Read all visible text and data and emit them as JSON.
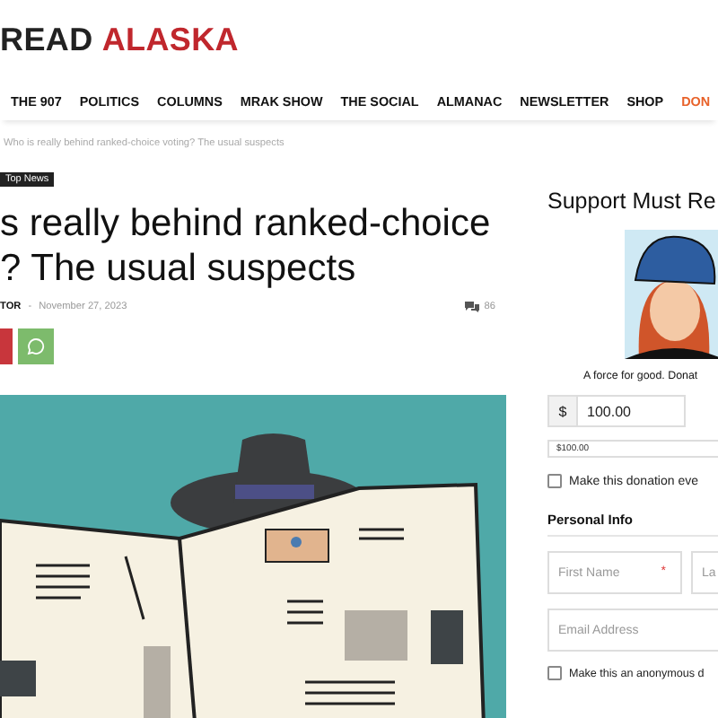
{
  "logo": {
    "dark": "READ",
    "accent": "ALASKA"
  },
  "nav": [
    {
      "label": "THE 907",
      "accent": false
    },
    {
      "label": "POLITICS",
      "accent": false
    },
    {
      "label": "COLUMNS",
      "accent": false
    },
    {
      "label": "MRAK SHOW",
      "accent": false
    },
    {
      "label": "THE SOCIAL",
      "accent": false
    },
    {
      "label": "ALMANAC",
      "accent": false
    },
    {
      "label": "NEWSLETTER",
      "accent": false
    },
    {
      "label": "SHOP",
      "accent": false
    },
    {
      "label": "DON",
      "accent": true
    }
  ],
  "breadcrumb": "Who is really behind ranked-choice voting? The usual suspects",
  "category": "Top News",
  "headline": [
    "s really behind ranked-choice",
    "? The usual suspects"
  ],
  "meta": {
    "author": "TOR",
    "separator": "-",
    "date": "November 27, 2023",
    "comments": "86"
  },
  "share": [
    {
      "kind": "plain",
      "color": "#c8363c"
    },
    {
      "kind": "chat",
      "color": "#7dbb6c"
    }
  ],
  "sidebar": {
    "title": "Support Must Re",
    "caption": "A force for good. Donat",
    "currency": "$",
    "amount": "100.00",
    "level_select": "$100.00",
    "recurring": {
      "label": "Make this donation eve",
      "checked": false
    },
    "section": "Personal Info",
    "first_name": {
      "placeholder": "First Name",
      "required_mark": "*"
    },
    "last_name": {
      "placeholder": "La"
    },
    "email": {
      "placeholder": "Email Address"
    },
    "anonymous": {
      "label": "Make this an anonymous d",
      "checked": false
    }
  }
}
